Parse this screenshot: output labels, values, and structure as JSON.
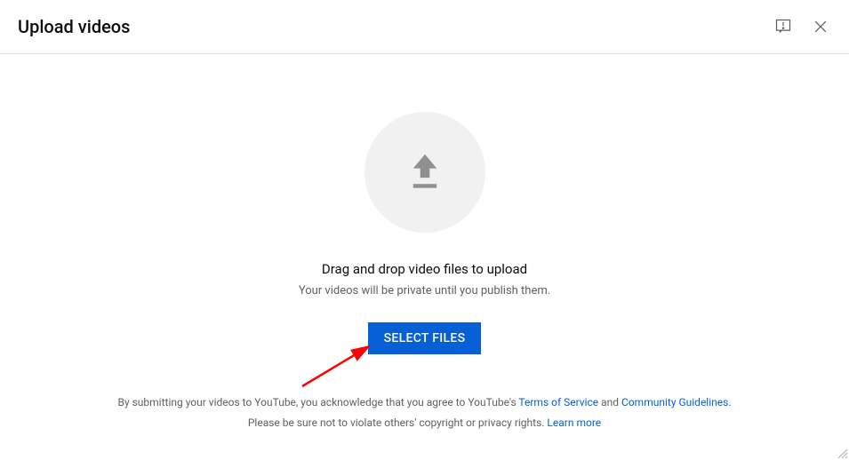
{
  "header": {
    "title": "Upload videos"
  },
  "main": {
    "drag_text": "Drag and drop video files to upload",
    "privacy_text": "Your videos will be private until you publish them.",
    "select_button": "SELECT FILES"
  },
  "footer": {
    "line1_prefix": "By submitting your videos to YouTube, you acknowledge that you agree to YouTube's ",
    "terms_link": "Terms of Service",
    "line1_and": " and ",
    "guidelines_link": "Community Guidelines",
    "line1_suffix": ".",
    "line2_prefix": "Please be sure not to violate others' copyright or privacy rights. ",
    "learn_more_link": "Learn more"
  }
}
